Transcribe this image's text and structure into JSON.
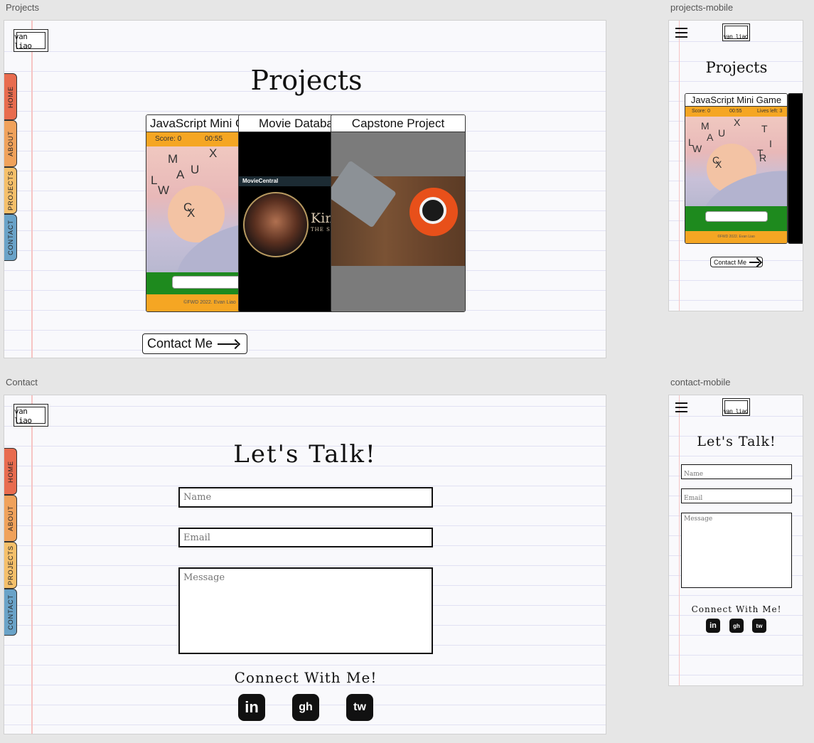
{
  "frames": {
    "projects": "Projects",
    "projects_mobile": "projects-mobile",
    "contact": "Contact",
    "contact_mobile": "contact-mobile"
  },
  "logo": {
    "text": "van liao"
  },
  "nav_tabs": [
    "HOME",
    "ABOUT",
    "PROJECTS",
    "CONTACT"
  ],
  "colors": {
    "home_tab": "#e86c4f",
    "about_tab": "#f0a25b",
    "projects_tab": "#f5c06a",
    "contact_tab": "#6aa3c8",
    "game_orange": "#f5a623",
    "game_green": "#1e8a1e"
  },
  "projects_page": {
    "title": "Projects",
    "cards": [
      {
        "title": "JavaScript Mini Game"
      },
      {
        "title": "Movie Database"
      },
      {
        "title": "Capstone Project"
      }
    ],
    "game": {
      "score": "Score: 0",
      "timer": "00:55",
      "lives": "Lives left: 3",
      "footer": "©FWD 2022. Evan Liao",
      "letters": [
        "M",
        "X",
        "A",
        "U",
        "L",
        "W",
        "C",
        "X"
      ],
      "mobile_letters": [
        "M",
        "X",
        "A",
        "U",
        "T",
        "L",
        "W",
        "I",
        "T",
        "C",
        "R",
        "X"
      ]
    },
    "movie": {
      "brand": "MovieCentral",
      "poster_title": "Kin",
      "poster_sub": "THE SE"
    },
    "contact_button": "Contact Me"
  },
  "contact_page": {
    "title": "Let's Talk!",
    "name_placeholder": "Name",
    "email_placeholder": "Email",
    "message_placeholder": "Message",
    "connect_title": "Connect With Me!",
    "socials": [
      {
        "name": "linkedin",
        "glyph": "in"
      },
      {
        "name": "github",
        "glyph": "gh"
      },
      {
        "name": "twitter",
        "glyph": "tw"
      }
    ]
  }
}
